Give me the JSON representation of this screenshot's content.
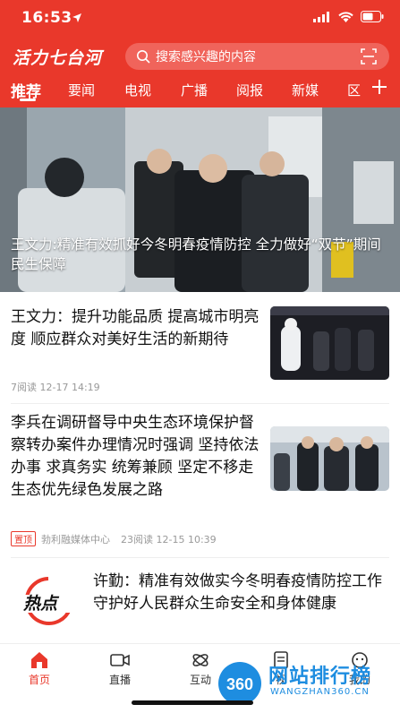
{
  "status_bar": {
    "time": "16:53"
  },
  "app": {
    "brand": "活力七台河"
  },
  "search": {
    "placeholder": "搜索感兴趣的内容"
  },
  "tabs": [
    "推荐",
    "要闻",
    "电视",
    "广播",
    "阅报",
    "新媒",
    "区"
  ],
  "active_tab": "推荐",
  "hero": {
    "caption": "王文力:精准有效抓好今冬明春疫情防控 全力做好“双节”期间民生保障"
  },
  "articles": [
    {
      "title": "王文力：提升功能品质 提高城市明亮度 顺应群众对美好生活的新期待",
      "meta": "7阅读  12-17 14:19"
    },
    {
      "title": "李兵在调研督导中央生态环境保护督察转办案件办理情况时强调 坚持依法办事 求真务实 统筹兼顾 坚定不移走生态优先绿色发展之路",
      "badge": "置顶",
      "source": "勃利融媒体中心",
      "meta": "23阅读  12-15 10:39"
    },
    {
      "title": "许勤：精准有效做实今冬明春疫情防控工作 守护好人民群众生命安全和身体健康",
      "thumb_text": "热点"
    }
  ],
  "bottom_nav": [
    "首页",
    "直播",
    "互动",
    "视",
    "我的"
  ],
  "watermark": {
    "text": "网站排行榜",
    "sub": "WANGZHAN360.CN",
    "logo": "360"
  },
  "colors": {
    "brand_red": "#e9382b",
    "watermark_blue": "#1e8de0"
  }
}
